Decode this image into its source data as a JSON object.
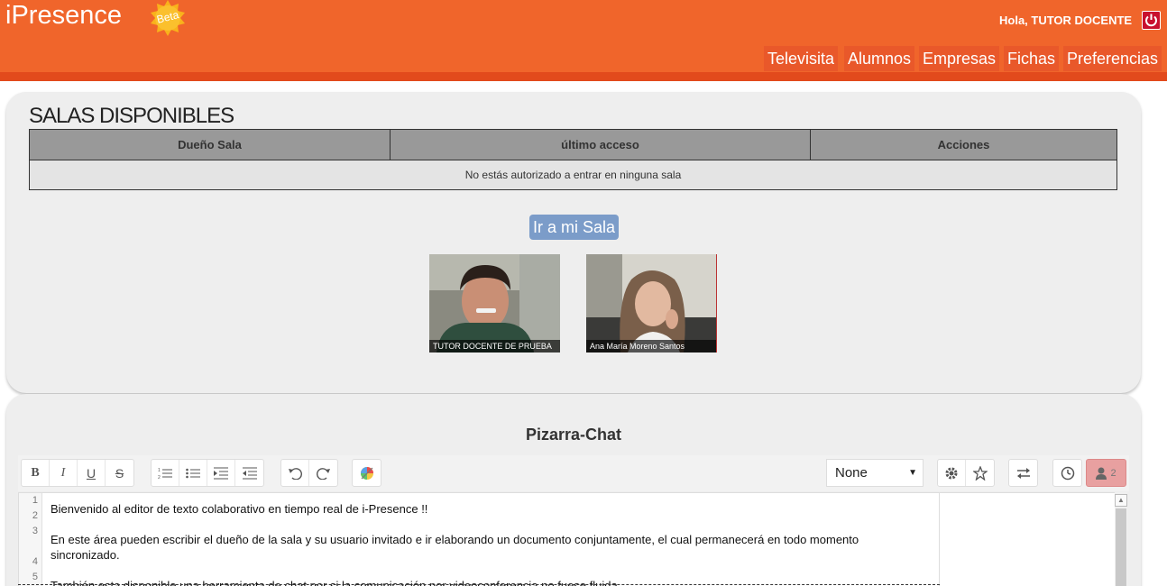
{
  "header": {
    "logo": "iPresence",
    "beta": "Beta",
    "greeting": "Hola, TUTOR DOCENTE",
    "nav": [
      "Televisita",
      "Alumnos",
      "Empresas",
      "Fichas",
      "Preferencias"
    ]
  },
  "salas": {
    "title": "SALAS DISPONIBLES",
    "columns": [
      "Dueño Sala",
      "último acceso",
      "Acciones"
    ],
    "empty_message": "No estás autorizado a entrar en ninguna sala",
    "go_button": "Ir a mi Sala"
  },
  "videos": [
    {
      "label": "TUTOR DOCENTE DE PRUEBA"
    },
    {
      "label": "Ana María Moreno Santos"
    }
  ],
  "pizarra": {
    "title": "Pizarra-Chat",
    "select_value": "None",
    "users_count": "2",
    "line_numbers": [
      "1",
      "2",
      "3",
      "4",
      "5"
    ],
    "lines": [
      "Bienvenido al editor de texto colaborativo en tiempo real de i-Presence !!",
      "En este área pueden escribir el dueño de la sala y su usuario invitado e ir elaborando un documento conjuntamente, el cual permanecerá en todo momento",
      "sincronizado.",
      "También esta disponible  una herramienta de chat por si la comunicación por videoconferencia no fuese fluida"
    ]
  },
  "colors": {
    "header": "#f0652b",
    "nav_item": "#e9582a",
    "go_button": "#7b9cc9",
    "users_button": "#e8a0a0"
  }
}
